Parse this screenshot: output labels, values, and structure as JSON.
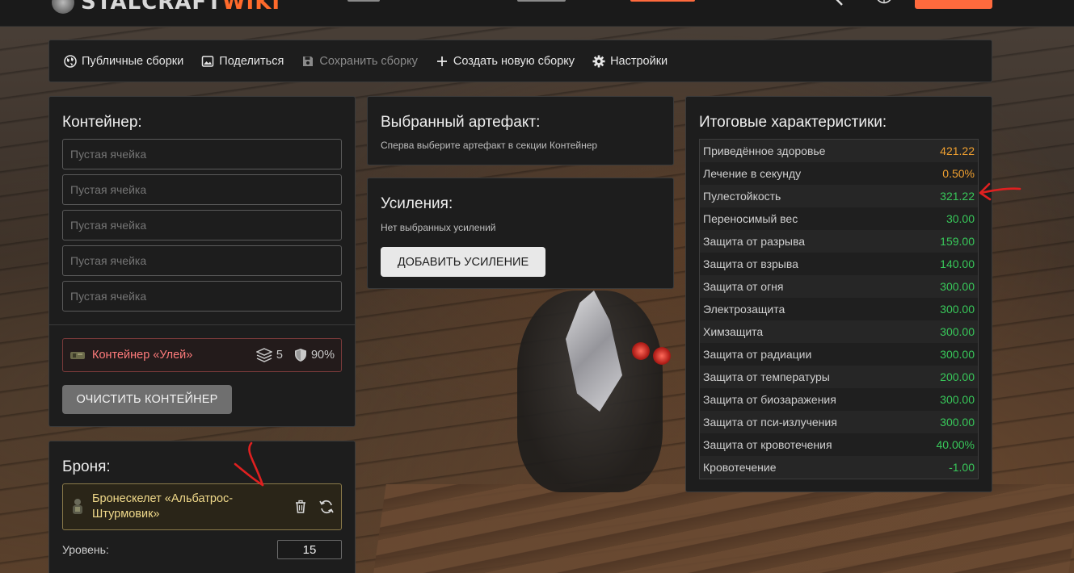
{
  "colors": {
    "accent": "#ff6a3d",
    "positive": "#38c85a",
    "highlight": "#f0a030",
    "container_border": "#7a3a3a",
    "armor_border": "#8a7a4a",
    "annotation": "#e02020"
  },
  "topbar": {
    "logo_icon": "stalcraft-logo-icon",
    "search_icon": "search-icon",
    "language_icon": "globe-icon"
  },
  "toolbar": {
    "items": [
      {
        "label": "Публичные сборки",
        "icon": "globe-icon",
        "enabled": true
      },
      {
        "label": "Поделиться",
        "icon": "image-icon",
        "enabled": true
      },
      {
        "label": "Сохранить сборку",
        "icon": "save-icon",
        "enabled": false
      },
      {
        "label": "Создать новую сборку",
        "icon": "plus-icon",
        "enabled": true
      },
      {
        "label": "Настройки",
        "icon": "gear-icon",
        "enabled": true
      }
    ]
  },
  "container": {
    "title": "Контейнер:",
    "slots": [
      "Пустая ячейка",
      "Пустая ячейка",
      "Пустая ячейка",
      "Пустая ячейка",
      "Пустая ячейка"
    ],
    "selected": {
      "name": "Контейнер «Улей»",
      "capacity": "5",
      "protection": "90%"
    },
    "clear_label": "ОЧИСТИТЬ КОНТЕЙНЕР"
  },
  "artifact": {
    "title": "Выбранный артефакт:",
    "hint": "Сперва выберите артефакт в секции Контейнер"
  },
  "boosts": {
    "title": "Усиления:",
    "hint": "Нет выбранных усилений",
    "add_label": "ДОБАВИТЬ УСИЛЕНИЕ"
  },
  "armor": {
    "title": "Броня:",
    "item_line1": "Бронескелет «Альбатрос-",
    "item_line2": "Штурмовик»",
    "level_label": "Уровень:",
    "level_value": "15"
  },
  "stats": {
    "title": "Итоговые характеристики:",
    "rows": [
      {
        "name": "Приведённое здоровье",
        "value": "421.22",
        "tone": "orange"
      },
      {
        "name": "Лечение в секунду",
        "value": "0.50%",
        "tone": "orange"
      },
      {
        "name": "Пулестойкость",
        "value": "321.22",
        "tone": "green"
      },
      {
        "name": "Переносимый вес",
        "value": "30.00",
        "tone": "green"
      },
      {
        "name": "Защита от разрыва",
        "value": "159.00",
        "tone": "green"
      },
      {
        "name": "Защита от взрыва",
        "value": "140.00",
        "tone": "green"
      },
      {
        "name": "Защита от огня",
        "value": "300.00",
        "tone": "green"
      },
      {
        "name": "Электрозащита",
        "value": "300.00",
        "tone": "green"
      },
      {
        "name": "Химзащита",
        "value": "300.00",
        "tone": "green"
      },
      {
        "name": "Защита от радиации",
        "value": "300.00",
        "tone": "green"
      },
      {
        "name": "Защита от температуры",
        "value": "200.00",
        "tone": "green"
      },
      {
        "name": "Защита от биозаражения",
        "value": "300.00",
        "tone": "green"
      },
      {
        "name": "Защита от пси-излучения",
        "value": "300.00",
        "tone": "green"
      },
      {
        "name": "Защита от кровотечения",
        "value": "40.00%",
        "tone": "green"
      },
      {
        "name": "Кровотечение",
        "value": "-1.00",
        "tone": "green"
      }
    ]
  }
}
